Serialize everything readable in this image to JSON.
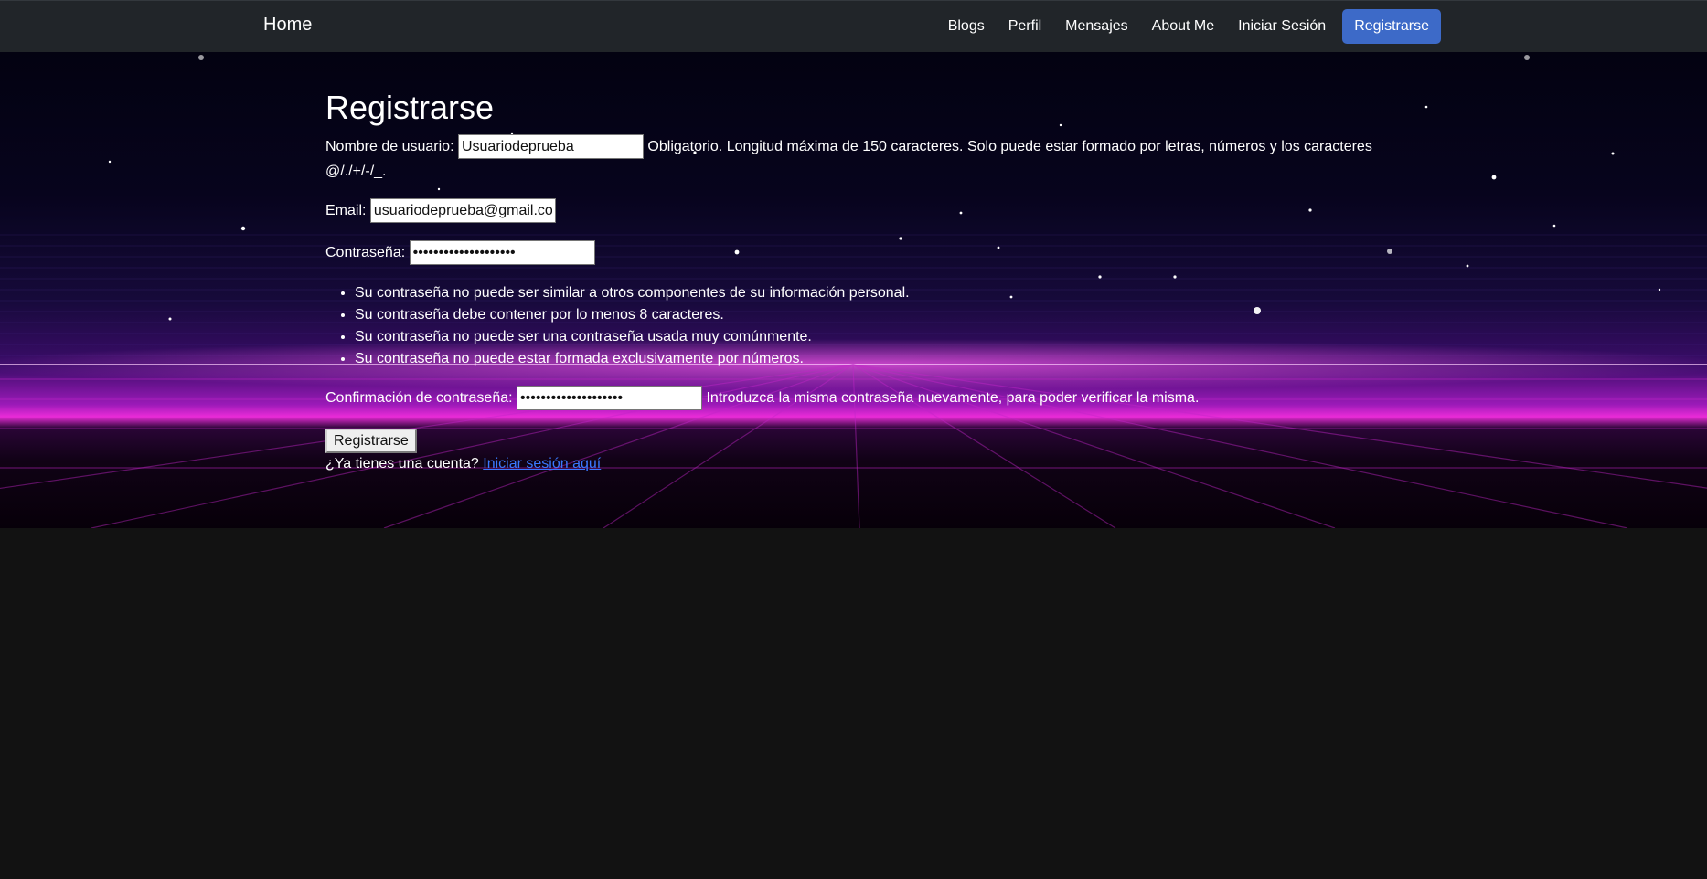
{
  "navbar": {
    "brand": "Home",
    "links": [
      {
        "label": "Blogs"
      },
      {
        "label": "Perfil"
      },
      {
        "label": "Mensajes"
      },
      {
        "label": "About Me"
      },
      {
        "label": "Iniciar Sesión"
      },
      {
        "label": "Registrarse",
        "active": true
      }
    ],
    "active_color": "#3d6ac8",
    "background": "#212529"
  },
  "form": {
    "title": "Registrarse",
    "username": {
      "label": "Nombre de usuario:",
      "value": "Usuariodeprueba",
      "help": "Obligatorio. Longitud máxima de 150 caracteres. Solo puede estar formado por letras, números y los caracteres @/./+/-/_."
    },
    "email": {
      "label": "Email:",
      "value": "usuariodeprueba@gmail.com"
    },
    "password": {
      "label": "Contraseña:",
      "value": "••••••••••••••••••••"
    },
    "password_rules": [
      "Su contraseña no puede ser similar a otros componentes de su información personal.",
      "Su contraseña debe contener por lo menos 8 caracteres.",
      "Su contraseña no puede ser una contraseña usada muy comúnmente.",
      "Su contraseña no puede estar formada exclusivamente por números."
    ],
    "password_confirm": {
      "label": "Confirmación de contraseña:",
      "value": "••••••••••••••••••••",
      "help": "Introduzca la misma contraseña nuevamente, para poder verificar la misma."
    },
    "submit_label": "Registrarse",
    "login_prompt": "¿Ya tienes una cuenta?",
    "login_link": "Iniciar sesión aquí"
  },
  "theme": {
    "page_background": "#121212",
    "link_color": "#3a78ff",
    "glow_color": "#ea2bd8"
  }
}
